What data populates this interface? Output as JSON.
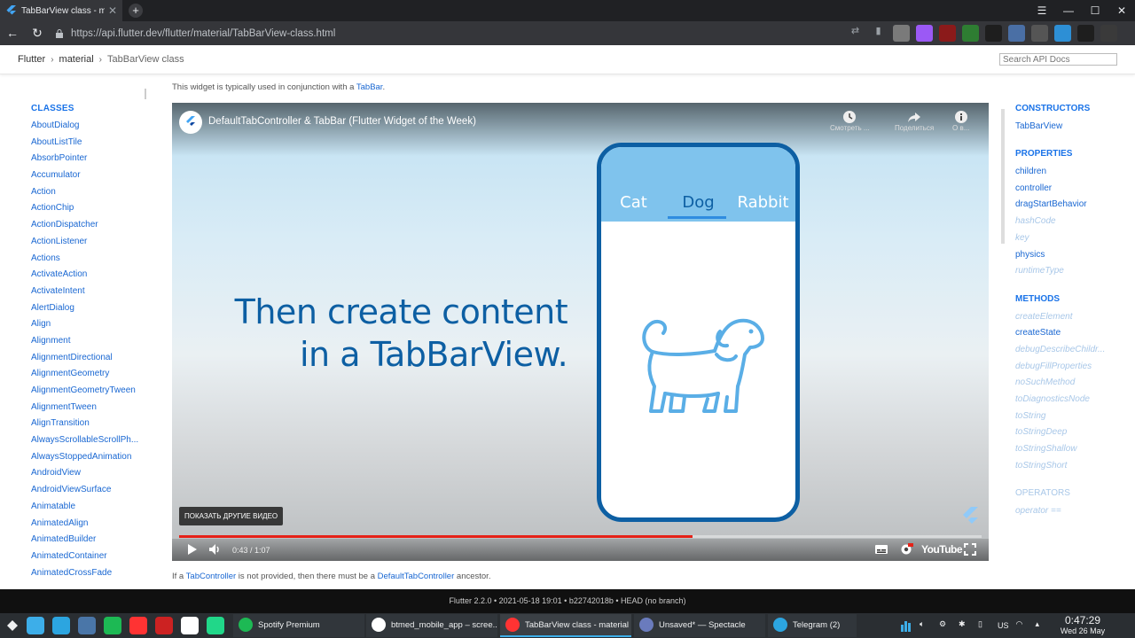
{
  "browser": {
    "tab_title": "TabBarView class - mat",
    "url": "https://api.flutter.dev/flutter/material/TabBarView-class.html",
    "extensions": [
      "#7a7a7a",
      "#9b59f5",
      "#8b1a1a",
      "#2e7d32",
      "#1e1e1e",
      "#4a6fa5",
      "#555",
      "#2d8fd5",
      "#1e1e1e",
      "#3a3a3a"
    ]
  },
  "header": {
    "crumbs": [
      "Flutter",
      "material",
      "TabBarView class"
    ],
    "search_placeholder": "Search API Docs"
  },
  "left_nav": {
    "heading": "CLASSES",
    "items": [
      "AboutDialog",
      "AboutListTile",
      "AbsorbPointer",
      "Accumulator",
      "Action",
      "ActionChip",
      "ActionDispatcher",
      "ActionListener",
      "Actions",
      "ActivateAction",
      "ActivateIntent",
      "AlertDialog",
      "Align",
      "Alignment",
      "AlignmentDirectional",
      "AlignmentGeometry",
      "AlignmentGeometryTween",
      "AlignmentTween",
      "AlignTransition",
      "AlwaysScrollableScrollPh...",
      "AlwaysStoppedAnimation",
      "AndroidView",
      "AndroidViewSurface",
      "Animatable",
      "AnimatedAlign",
      "AnimatedBuilder",
      "AnimatedContainer",
      "AnimatedCrossFade"
    ]
  },
  "content": {
    "intro_prefix": "This widget is typically used in conjunction with a ",
    "intro_link": "TabBar",
    "intro_suffix": ".",
    "outro_a": "If a ",
    "outro_link1": "TabController",
    "outro_b": " is not provided, then there must be a ",
    "outro_link2": "DefaultTabController",
    "outro_c": " ancestor."
  },
  "video": {
    "title": "DefaultTabController & TabBar (Flutter Widget of the Week)",
    "action_watch": "Смотреть ...",
    "action_share": "Поделиться",
    "action_info": "О в...",
    "headline_line1": "Then create content",
    "headline_line2": "in a TabBarView.",
    "phone_tabs": [
      "Cat",
      "Dog",
      "Rabbit"
    ],
    "more_videos": "ПОКАЗАТЬ ДРУГИЕ ВИДЕО",
    "time": "0:43 / 1:07",
    "progress": 0.64,
    "youtube_label": "YouTube"
  },
  "right_nav": {
    "constructors_heading": "CONSTRUCTORS",
    "constructors": [
      "TabBarView"
    ],
    "properties_heading": "PROPERTIES",
    "properties": [
      {
        "label": "children",
        "inherited": false
      },
      {
        "label": "controller",
        "inherited": false
      },
      {
        "label": "dragStartBehavior",
        "inherited": false
      },
      {
        "label": "hashCode",
        "inherited": true
      },
      {
        "label": "key",
        "inherited": true
      },
      {
        "label": "physics",
        "inherited": false
      },
      {
        "label": "runtimeType",
        "inherited": true
      }
    ],
    "methods_heading": "METHODS",
    "methods": [
      {
        "label": "createElement",
        "inherited": true
      },
      {
        "label": "createState",
        "inherited": false
      },
      {
        "label": "debugDescribeChildr...",
        "inherited": true
      },
      {
        "label": "debugFillProperties",
        "inherited": true
      },
      {
        "label": "noSuchMethod",
        "inherited": true
      },
      {
        "label": "toDiagnosticsNode",
        "inherited": true
      },
      {
        "label": "toString",
        "inherited": true
      },
      {
        "label": "toStringDeep",
        "inherited": true
      },
      {
        "label": "toStringShallow",
        "inherited": true
      },
      {
        "label": "toStringShort",
        "inherited": true
      }
    ],
    "operators_heading": "OPERATORS",
    "operators": [
      {
        "label": "operator ==",
        "inherited": true
      }
    ]
  },
  "footer": "Flutter 2.2.0 • 2021-05-18 19:01 • b22742018b • HEAD (no branch)",
  "taskbar": {
    "launchers": [
      "#3daee9",
      "#2ca5e0",
      "#4a76a8",
      "#1db954",
      "#ff3333",
      "#cc2222",
      "#ffffff",
      "#21d789"
    ],
    "tasks": [
      {
        "label": "Spotify Premium",
        "color": "#1db954",
        "active": false
      },
      {
        "label": "btmed_mobile_app – scree...",
        "color": "#ffffff",
        "active": false
      },
      {
        "label": "TabBarView class - material ...",
        "color": "#ff3333",
        "active": true
      },
      {
        "label": "Unsaved* — Spectacle",
        "color": "#6a7bbd",
        "active": false
      },
      {
        "label": "Telegram (2)",
        "color": "#2ca5e0",
        "active": false
      }
    ],
    "keyboard_layout": "US",
    "clock_time": "0:47:29",
    "clock_date": "Wed 26 May"
  }
}
